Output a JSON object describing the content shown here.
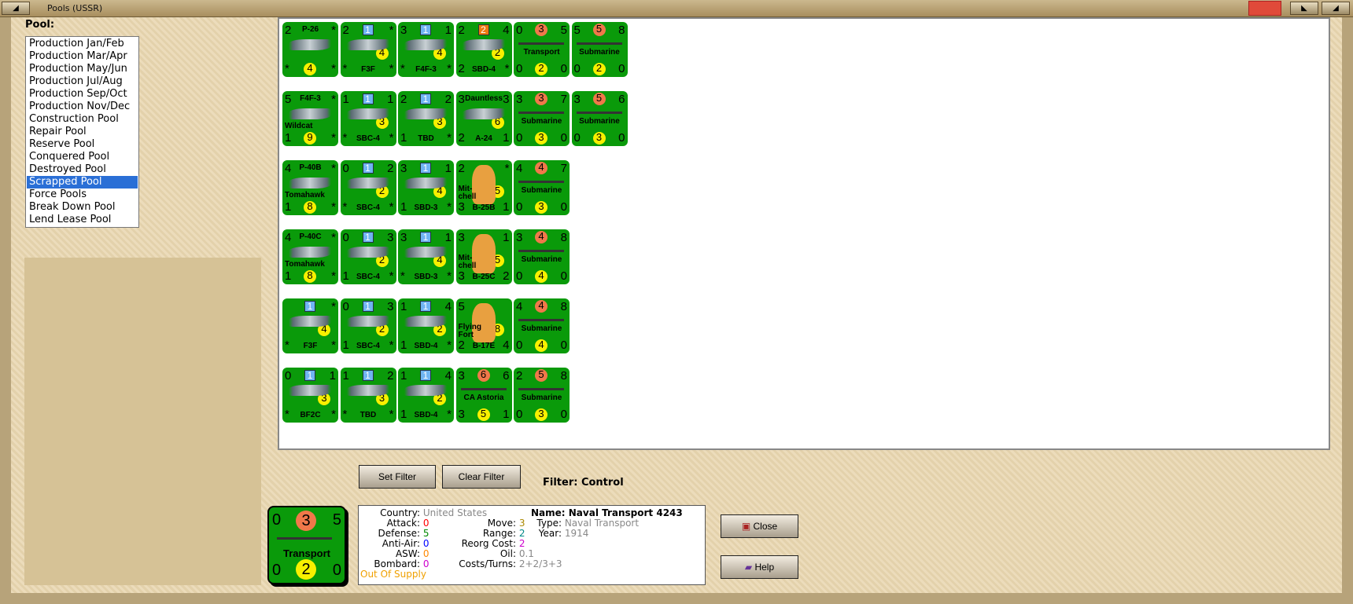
{
  "window": {
    "title": "Pools (USSR)"
  },
  "pool_label": "Pool:",
  "pools": [
    "Production Jan/Feb",
    "Production Mar/Apr",
    "Production May/Jun",
    "Production Jul/Aug",
    "Production Sep/Oct",
    "Production Nov/Dec",
    "Construction Pool",
    "Repair Pool",
    "Reserve Pool",
    "Conquered Pool",
    "Destroyed Pool",
    "Scrapped Pool",
    "Force Pools",
    "Break Down Pool",
    "Lend Lease Pool"
  ],
  "selected_pool": "Scrapped Pool",
  "counters": [
    [
      {
        "tl": "2",
        "top": "P-26",
        "tr": "*",
        "bl": "*",
        "c": "4",
        "br": "*",
        "kind": "air"
      },
      {
        "tl": "2",
        "blue": "1",
        "tr": "*",
        "bl": "*",
        "r": "4",
        "bot": "F3F",
        "br": "*",
        "kind": "air"
      },
      {
        "tl": "3",
        "blue": "1",
        "tr": "1",
        "bl": "*",
        "r": "4",
        "bot": "F4F-3",
        "br": "*",
        "kind": "air"
      },
      {
        "tl": "2",
        "orange": "2",
        "tr": "4",
        "bl": "2",
        "r": "2",
        "bot": "SBD-4",
        "br": "*",
        "kind": "air"
      },
      {
        "tl": "0",
        "red": "3",
        "tr": "5",
        "mid": "Transport",
        "bl": "0",
        "c": "2",
        "br": "0",
        "kind": "ship"
      },
      {
        "tl": "5",
        "red": "5",
        "tr": "8",
        "mid": "Submarine",
        "bl": "0",
        "c": "2",
        "br": "0",
        "kind": "ship"
      }
    ],
    [
      {
        "tl": "5",
        "top": "F4F-3",
        "tr": "*",
        "mid": "Wildcat",
        "bl": "1",
        "c": "9",
        "br": "*",
        "kind": "air"
      },
      {
        "tl": "1",
        "blue": "1",
        "tr": "1",
        "bl": "*",
        "r": "3",
        "bot": "SBC-4",
        "br": "*",
        "kind": "air"
      },
      {
        "tl": "2",
        "blue": "1",
        "tr": "2",
        "bl": "1",
        "r": "3",
        "bot": "TBD",
        "br": "*",
        "kind": "air"
      },
      {
        "tl": "3",
        "top": "Dauntless",
        "tr": "3",
        "bl": "2",
        "r": "6",
        "bot": "A-24",
        "br": "1",
        "kind": "air"
      },
      {
        "tl": "3",
        "red": "3",
        "tr": "7",
        "mid": "Submarine",
        "bl": "0",
        "c": "3",
        "br": "0",
        "kind": "ship"
      },
      {
        "tl": "3",
        "red": "5",
        "tr": "6",
        "mid": "Submarine",
        "bl": "0",
        "c": "3",
        "br": "0",
        "kind": "ship"
      }
    ],
    [
      {
        "tl": "4",
        "top": "P-40B",
        "tr": "*",
        "mid": "Tomahawk",
        "bl": "1",
        "c": "8",
        "br": "*",
        "kind": "air"
      },
      {
        "tl": "0",
        "blue": "1",
        "tr": "2",
        "bl": "*",
        "r": "2",
        "bot": "SBC-4",
        "br": "*",
        "kind": "air"
      },
      {
        "tl": "3",
        "blue": "1",
        "tr": "1",
        "bl": "1",
        "r": "4",
        "bot": "SBD-3",
        "br": "*",
        "kind": "air"
      },
      {
        "tl": "2",
        "tr": "*",
        "mid": "Mit-chell",
        "bl": "3",
        "r": "5",
        "bot": "B-25B",
        "br": "1",
        "kind": "bomber"
      },
      {
        "tl": "4",
        "red": "4",
        "tr": "7",
        "mid": "Submarine",
        "bl": "0",
        "c": "3",
        "br": "0",
        "kind": "ship"
      }
    ],
    [
      {
        "tl": "4",
        "top": "P-40C",
        "tr": "*",
        "mid": "Tomahawk",
        "bl": "1",
        "c": "8",
        "br": "*",
        "kind": "air"
      },
      {
        "tl": "0",
        "blue": "1",
        "tr": "3",
        "bl": "1",
        "r": "2",
        "bot": "SBC-4",
        "br": "*",
        "kind": "air"
      },
      {
        "tl": "3",
        "blue": "1",
        "tr": "1",
        "bl": "*",
        "r": "4",
        "bot": "SBD-3",
        "br": "*",
        "kind": "air"
      },
      {
        "tl": "3",
        "tr": "1",
        "mid": "Mit-chell",
        "bl": "3",
        "r": "5",
        "bot": "B-25C",
        "br": "2",
        "kind": "bomber"
      },
      {
        "tl": "3",
        "red": "4",
        "tr": "8",
        "mid": "Submarine",
        "bl": "0",
        "c": "4",
        "br": "0",
        "kind": "ship"
      }
    ],
    [
      {
        "tl": "",
        "blue": "1",
        "tr": "*",
        "bl": "*",
        "r": "4",
        "bot": "F3F",
        "br": "*",
        "kind": "air"
      },
      {
        "tl": "0",
        "blue": "1",
        "tr": "3",
        "bl": "1",
        "r": "2",
        "bot": "SBC-4",
        "br": "*",
        "kind": "air"
      },
      {
        "tl": "1",
        "blue": "1",
        "tr": "4",
        "bl": "1",
        "r": "2",
        "bot": "SBD-4",
        "br": "*",
        "kind": "air"
      },
      {
        "tl": "5",
        "tr": "",
        "mid": "Flying Fort",
        "bl": "2",
        "r": "8",
        "bot": "B-17E",
        "br": "4",
        "kind": "bomber"
      },
      {
        "tl": "4",
        "red": "4",
        "tr": "8",
        "mid": "Submarine",
        "bl": "0",
        "c": "4",
        "br": "0",
        "kind": "ship"
      }
    ],
    [
      {
        "tl": "0",
        "blue": "1",
        "tr": "1",
        "bl": "*",
        "r": "3",
        "bot": "BF2C",
        "br": "*",
        "kind": "air"
      },
      {
        "tl": "1",
        "blue": "1",
        "tr": "2",
        "bl": "*",
        "r": "3",
        "bot": "TBD",
        "br": "*",
        "kind": "air"
      },
      {
        "tl": "1",
        "blue": "1",
        "tr": "4",
        "bl": "1",
        "r": "2",
        "bot": "SBD-4",
        "br": "*",
        "kind": "air"
      },
      {
        "tl": "3",
        "red": "6",
        "tr": "6",
        "mid": "CA Astoria",
        "bl": "3",
        "c": "5",
        "br": "1",
        "kind": "ship"
      },
      {
        "tl": "2",
        "red": "5",
        "tr": "8",
        "mid": "Submarine",
        "bl": "0",
        "c": "3",
        "br": "0",
        "kind": "ship"
      }
    ]
  ],
  "buttons": {
    "set_filter": "Set Filter",
    "clear_filter": "Clear Filter",
    "close": "Close",
    "help": "Help"
  },
  "filter": "Filter:  Control",
  "selected_counter": {
    "tl": "0",
    "red": "3",
    "tr": "5",
    "mid": "Transport",
    "bl": "0",
    "c": "2",
    "br": "0"
  },
  "info": {
    "country_label": "Country:",
    "country": "United States",
    "attack_label": "Attack:",
    "attack": "0",
    "defense_label": "Defense:",
    "defense": "5",
    "antiair_label": "Anti-Air:",
    "antiair": "0",
    "asw_label": "ASW:",
    "asw": "0",
    "bombard_label": "Bombard:",
    "bombard": "0",
    "supply": "Out Of Supply",
    "move_label": "Move:",
    "move": "3",
    "range_label": "Range:",
    "range": "2",
    "reorg_label": "Reorg Cost:",
    "reorg": "2",
    "oil_label": "Oil:",
    "oil": "0.1",
    "costs_label": "Costs/Turns:",
    "costs": "2+2/3+3",
    "name": "Name: Naval Transport 4243",
    "type_label": "Type:",
    "type": "Naval Transport",
    "year_label": "Year:",
    "year": "1914"
  },
  "colors": {
    "counter": "#0a9a0a",
    "selected": "#2a6fd6",
    "red": "#ff0000",
    "green": "#008000",
    "blue": "#0000ff",
    "orange": "#ff8c00",
    "magenta": "#cc00cc",
    "teal": "#008080",
    "olive": "#998800",
    "gray": "#888888"
  }
}
